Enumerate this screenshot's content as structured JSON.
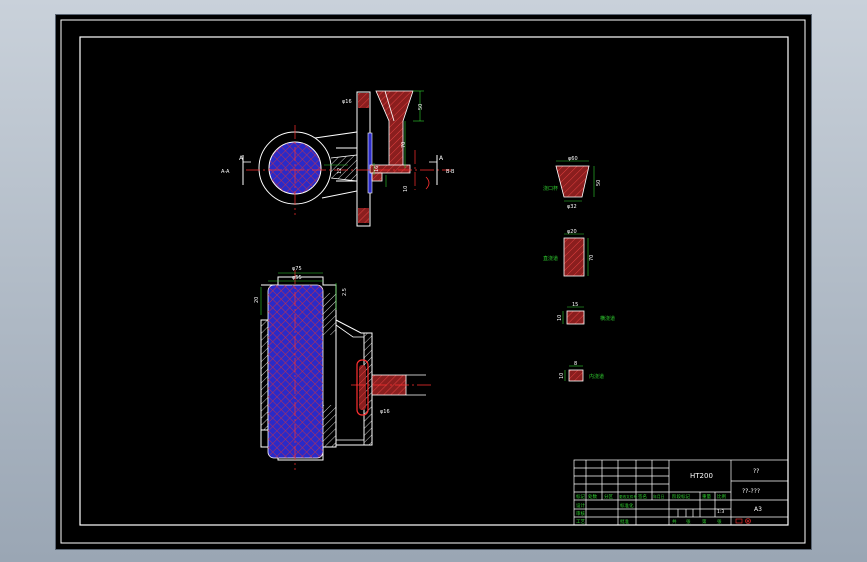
{
  "title_block": {
    "material": "HT200",
    "name": "??",
    "drawing_no": "??-???",
    "sheet_size": "A3",
    "scale": "1:3",
    "left_grid": [
      "标记",
      "处数",
      "分区",
      "更改文件号",
      "签名",
      "年月日",
      "设计",
      "标准化",
      "审核",
      "工艺",
      "批准"
    ],
    "mid_grid": [
      "阶段标记",
      "重量",
      "比例",
      "共",
      "张",
      "第",
      "张"
    ]
  },
  "top_view": {
    "section_mark_left": "A",
    "section_mark_right": "A",
    "view_label_left": "A-A",
    "view_label_right": "B-B",
    "dim_phi": "φ16",
    "dim_50": "50",
    "dim_70": "70",
    "dim_12": "12",
    "dim_16": "16",
    "dim_10": "10"
  },
  "bottom_view": {
    "dim_phi75": "φ75",
    "dim_phi55": "φ55",
    "dim_20": "20",
    "dim_25": "2.5",
    "dim_phi": "φ16"
  },
  "side_sections": [
    {
      "label": "浇口杯",
      "dim_top": "φ60",
      "dim_bottom": "φ32",
      "dim_side": "50"
    },
    {
      "label": "直浇道",
      "dim_top": "φ20",
      "dim_side": "70"
    },
    {
      "label": "横浇道",
      "dim_top": "15",
      "dim_side": "10"
    },
    {
      "label": "内浇道",
      "dim_top": "8",
      "dim_side": "10"
    }
  ]
}
